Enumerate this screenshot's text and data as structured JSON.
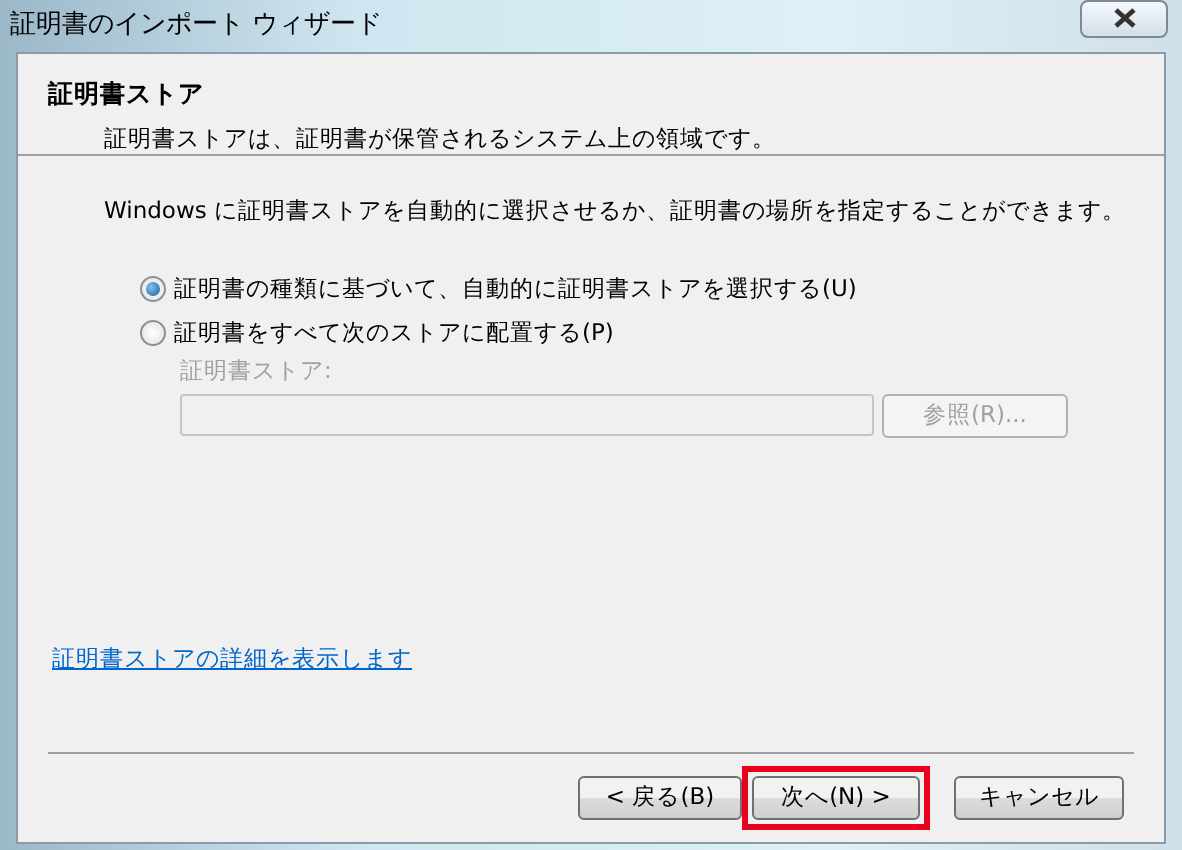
{
  "window": {
    "title": "証明書のインポート ウィザード"
  },
  "header": {
    "title": "証明書ストア",
    "subtitle": "証明書ストアは、証明書が保管されるシステム上の領域です。"
  },
  "intro": "Windows に証明書ストアを自動的に選択させるか、証明書の場所を指定することができます。",
  "options": [
    {
      "label": "証明書の種類に基づいて、自動的に証明書ストアを選択する(U)",
      "selected": true
    },
    {
      "label": "証明書をすべて次のストアに配置する(P)",
      "selected": false
    }
  ],
  "store": {
    "label": "証明書ストア:",
    "disabled": true,
    "browse": "参照(R)..."
  },
  "link": "証明書ストアの詳細を表示します",
  "buttons": [
    {
      "label": "< 戻る(B)",
      "highlighted": false
    },
    {
      "label": "次へ(N) >",
      "highlighted": true
    },
    {
      "label": "キャンセル",
      "highlighted": false
    }
  ]
}
